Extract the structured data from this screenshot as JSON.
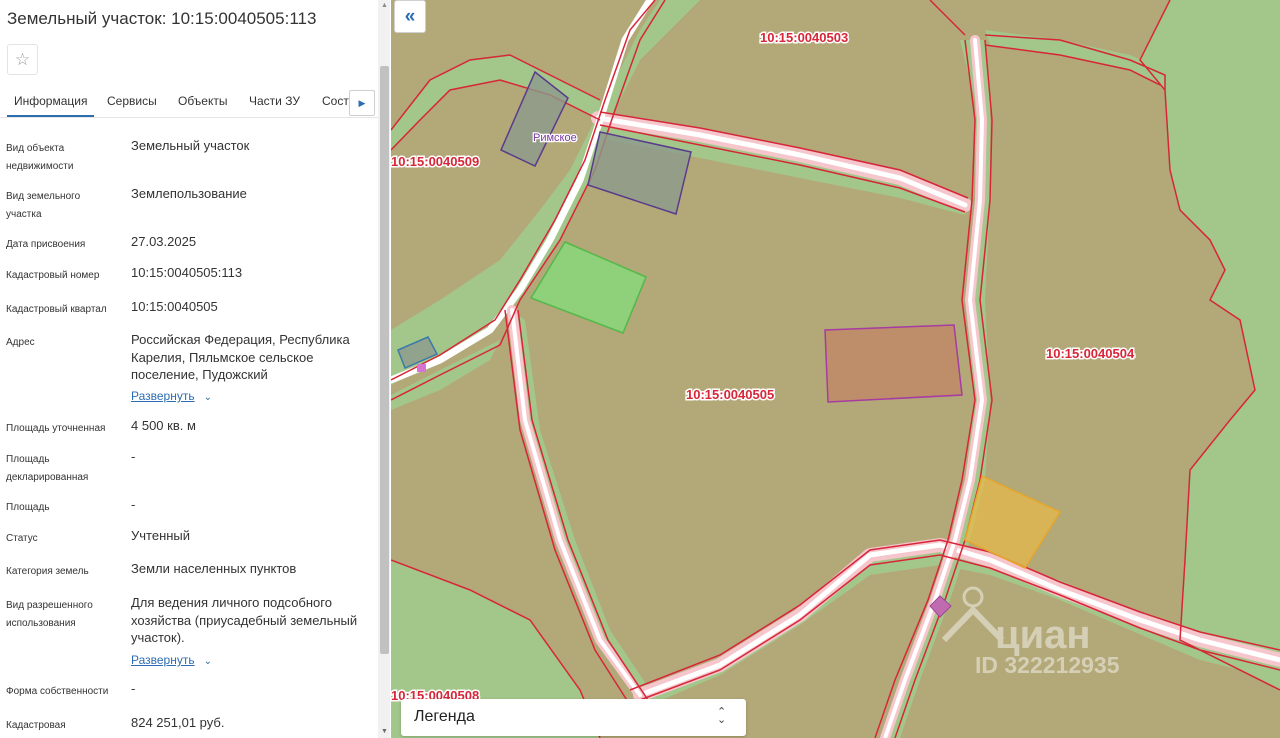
{
  "title": "Земельный участок: 10:15:0040505:113",
  "star_icon": "☆",
  "tabs": [
    {
      "label": "Информация",
      "active": true
    },
    {
      "label": "Сервисы",
      "active": false
    },
    {
      "label": "Объекты",
      "active": false
    },
    {
      "label": "Части ЗУ",
      "active": false
    },
    {
      "label": "Соста",
      "active": false
    }
  ],
  "expand_link": "Развернуть",
  "fields": [
    {
      "label": "Вид объекта недвижимости",
      "value": "Земельный участок"
    },
    {
      "label": "Вид земельного участка",
      "value": "Землепользование"
    },
    {
      "label": "Дата присвоения",
      "value": "27.03.2025"
    },
    {
      "label": "Кадастровый номер",
      "value": "10:15:0040505:113"
    },
    {
      "label": "Кадастровый квартал",
      "value": "10:15:0040505"
    },
    {
      "label": "Адрес",
      "value": "Российская Федерация, Республика Карелия, Пяльмское сельское поселение, Пудожский"
    },
    {
      "label": "Площадь уточненная",
      "value": "4 500 кв. м"
    },
    {
      "label": "Площадь декларированная",
      "value": "-"
    },
    {
      "label": "Площадь",
      "value": "-"
    },
    {
      "label": "Статус",
      "value": "Учтенный"
    },
    {
      "label": "Категория земель",
      "value": "Земли населенных пунктов"
    },
    {
      "label": "Вид разрешенного использования",
      "value": "Для ведения личного подсобного хозяйства (приусадебный земельный участок)."
    },
    {
      "label": "Форма собственности",
      "value": "-"
    },
    {
      "label": "Кадастровая",
      "value": "824 251,01 руб."
    }
  ],
  "map": {
    "labels": {
      "q503": "10:15:0040503",
      "q509": "10:15:0040509",
      "q505": "10:15:0040505",
      "q504": "10:15:0040504",
      "q508": "10:15:0040508",
      "village": "Римское"
    },
    "watermark": {
      "brand": "циан",
      "id": "ID 322212935"
    },
    "colors": {
      "parcel_fill": "#b3a878",
      "green_area": "#a3c78a",
      "boundary": "#d72638",
      "road": "#ffffff",
      "road_edge": "#f5c6cb",
      "label": "#d72638"
    }
  },
  "collapse_icon": "«",
  "legend": {
    "label": "Легенда"
  }
}
